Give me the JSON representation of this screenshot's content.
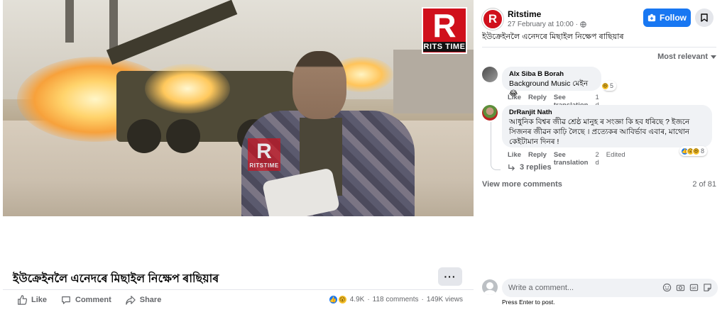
{
  "video": {
    "watermark_main": "R",
    "watermark_main_sub": "RITS TIME",
    "watermark_mid": "R",
    "watermark_mid_sub": "RITSTIME"
  },
  "post": {
    "title": "ইউক্ৰেইনলৈ এনেদৰে মিছাইল নিক্ষেপ ৰাছিয়াৰ",
    "more_label": "···",
    "actions": {
      "like": "Like",
      "comment": "Comment",
      "share": "Share"
    },
    "stats": {
      "reactions": "4.9K",
      "comments": "118 comments",
      "views": "149K views"
    }
  },
  "panel": {
    "page_name": "Ritstime",
    "avatar_letter": "R",
    "date": "27 February at 10:00 ·",
    "follow_label": "Follow",
    "caption": "ইউক্ৰেইনলৈ এনেদৰে মিছাইল নিক্ষেপ ৰাছিয়াৰ",
    "sort_label": "Most relevant",
    "comments": [
      {
        "author": "Alx Siba B Borah",
        "text": "Background Music মেইন😂",
        "like": "Like",
        "reply": "Reply",
        "translate": "See translation",
        "time": "1 d",
        "reaction_count": "5"
      },
      {
        "author": "DrRanjit Nath",
        "text": "আধুনিক বিশ্বৰ জীৱ শ্ৰেষ্ঠ মানুহ ৰ সংজ্ঞা কি হব ধৰিছে ? ইজনে সিজনৰ জীৱন কাঢ়ি লৈছে । প্ৰত্যেকৰ আবিৰ্ভাব এবাৰ, মাথোন কেইটামান দিনৰ !",
        "like": "Like",
        "reply": "Reply",
        "translate": "See translation",
        "time": "2 d",
        "edited": "Edited",
        "reaction_count": "8",
        "replies_label": "3 replies"
      }
    ],
    "view_more": "View more comments",
    "count": "2 of 81",
    "write_placeholder": "Write a comment...",
    "hint": "Press Enter to post."
  },
  "colors": {
    "brand_red": "#d0101c",
    "facebook_blue": "#1877f2",
    "secondary_text": "#65676b",
    "bubble_bg": "#f0f2f5"
  }
}
